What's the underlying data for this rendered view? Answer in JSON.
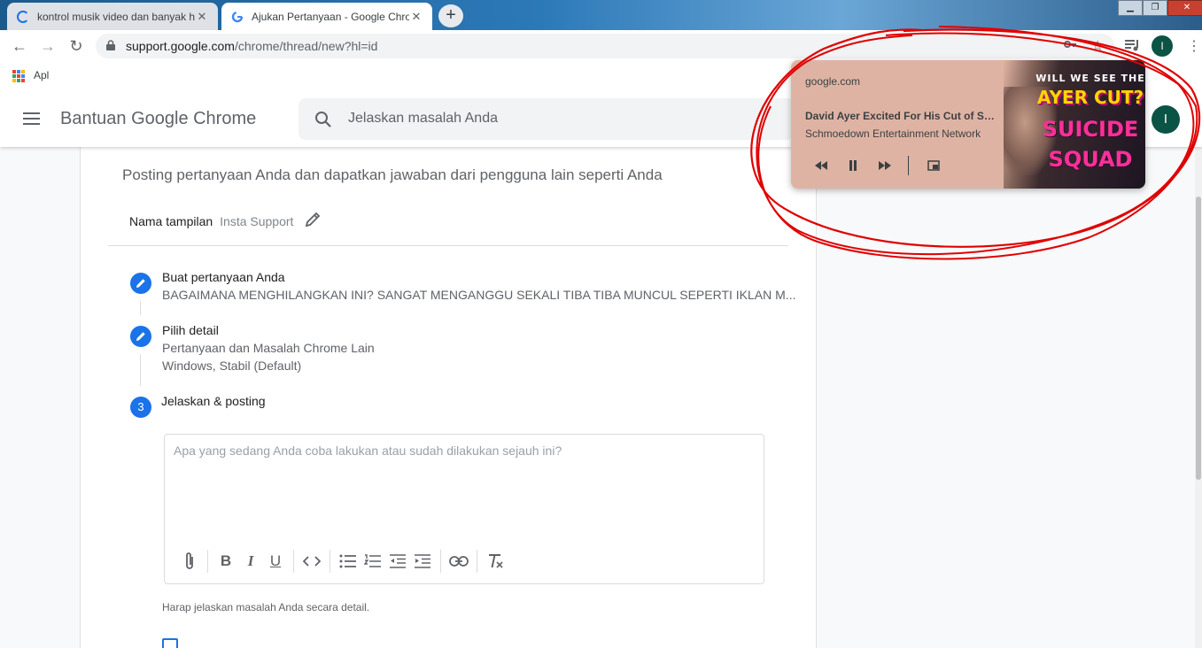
{
  "tabs": [
    {
      "title": "kontrol musik video dan banyak hal l",
      "state": "loading"
    },
    {
      "title": "Ajukan Pertanyaan - Google Chrome",
      "state": "active"
    }
  ],
  "omnibox": {
    "host": "support.google.com",
    "path": "/chrome/thread/new?hl=id"
  },
  "bookmarks": {
    "apps_label": "Apl"
  },
  "profile_initial": "I",
  "appbar": {
    "title": "Bantuan Google Chrome",
    "search_placeholder": "Jelaskan masalah Anda"
  },
  "form": {
    "subtitle": "Posting pertanyaan Anda dan dapatkan jawaban dari pengguna lain seperti Anda",
    "display_name_label": "Nama tampilan",
    "display_name_value": "Insta Support",
    "steps": [
      {
        "title": "Buat pertanyaan Anda",
        "detail": "BAGAIMANA MENGHILANGKAN INI? SANGAT MENGANGGU SEKALI TIBA TIBA MUNCUL SEPERTI IKLAN M..."
      },
      {
        "title": "Pilih detail",
        "detail": "Pertanyaan dan Masalah Chrome Lain",
        "detail2": "Windows, Stabil (Default)"
      },
      {
        "number": "3",
        "title": "Jelaskan & posting"
      }
    ],
    "editor_placeholder": "Apa yang sedang Anda coba lakukan atau sudah dilakukan sejauh ini?",
    "hint": "Harap jelaskan masalah Anda secara detail."
  },
  "media": {
    "origin": "google.com",
    "title": "David Ayer Excited For His Cut of Suicide Squad",
    "artist": "Schmoedown Entertainment Network",
    "artwork_text": [
      "WILL WE SEE THE",
      "AYER CUT?",
      "SUICIDE",
      "SQUAD"
    ]
  },
  "colors": {
    "accent": "#1a73e8",
    "media_bg": "#dfb3a3",
    "annotation": "#e00000",
    "avatar": "#0b5345"
  }
}
